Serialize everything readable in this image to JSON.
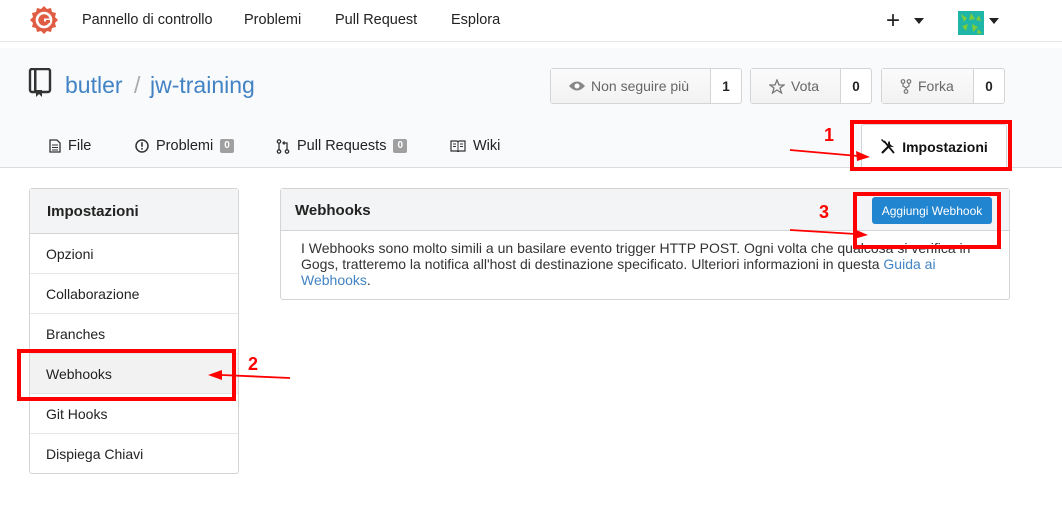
{
  "navbar": {
    "items": [
      "Pannello di controllo",
      "Problemi",
      "Pull Request",
      "Esplora"
    ],
    "plus_label": "+",
    "logo_icon": "gogs-logo",
    "logo_color": "#e05d44"
  },
  "repo": {
    "owner": "butler",
    "separator": "/",
    "name": "jw-training",
    "watch": {
      "label": "Non seguire più",
      "count": "1"
    },
    "star": {
      "label": "Vota",
      "count": "0"
    },
    "fork": {
      "label": "Forka",
      "count": "0"
    }
  },
  "tabs": [
    {
      "label": "File",
      "icon": "file-icon"
    },
    {
      "label": "Problemi",
      "icon": "issue-icon",
      "badge": "0"
    },
    {
      "label": "Pull Requests",
      "icon": "pull-request-icon",
      "badge": "0"
    },
    {
      "label": "Wiki",
      "icon": "book-icon"
    },
    {
      "label": "Impostazioni",
      "icon": "tools-icon"
    }
  ],
  "sidebar": {
    "title": "Impostazioni",
    "items": [
      "Opzioni",
      "Collaborazione",
      "Branches",
      "Webhooks",
      "Git Hooks",
      "Dispiega Chiavi"
    ],
    "active_index": 3
  },
  "webhooks": {
    "title": "Webhooks",
    "add_button": "Aggiungi Webhook",
    "description": "I Webhooks sono molto simili a un basilare evento trigger HTTP POST. Ogni volta che qualcosa si verifica in Gogs, tratteremo la notifica all'host di destinazione specificato. Ulteriori informazioni in questa ",
    "link_text": "Guida ai Webhooks",
    "description_end": "."
  },
  "annotations": {
    "labels": [
      "1",
      "2",
      "3"
    ],
    "color": "#ff0000"
  },
  "colors": {
    "link": "#4183c4",
    "primary_button": "#2185d0"
  }
}
